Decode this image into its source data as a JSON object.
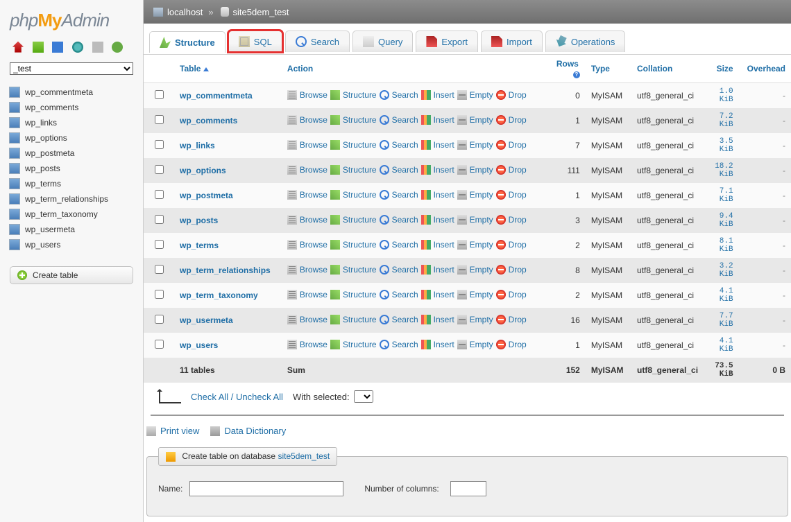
{
  "logo": {
    "p": "php",
    "m": "My",
    "a": "Admin"
  },
  "breadcrumb": {
    "server": "localhost",
    "db": "site5dem_test"
  },
  "db_selected": "_test",
  "tabs": [
    {
      "id": "structure",
      "label": "Structure",
      "active": true
    },
    {
      "id": "sql",
      "label": "SQL",
      "highlight": true
    },
    {
      "id": "search",
      "label": "Search"
    },
    {
      "id": "query",
      "label": "Query"
    },
    {
      "id": "export",
      "label": "Export"
    },
    {
      "id": "import",
      "label": "Import"
    },
    {
      "id": "operations",
      "label": "Operations"
    }
  ],
  "tree": [
    "wp_commentmeta",
    "wp_comments",
    "wp_links",
    "wp_options",
    "wp_postmeta",
    "wp_posts",
    "wp_terms",
    "wp_term_relationships",
    "wp_term_taxonomy",
    "wp_usermeta",
    "wp_users"
  ],
  "sidebar": {
    "create_table": "Create table"
  },
  "columns": {
    "table": "Table",
    "action": "Action",
    "rows": "Rows",
    "type": "Type",
    "collation": "Collation",
    "size": "Size",
    "overhead": "Overhead"
  },
  "actions": {
    "browse": "Browse",
    "structure": "Structure",
    "search": "Search",
    "insert": "Insert",
    "empty": "Empty",
    "drop": "Drop"
  },
  "tables": [
    {
      "name": "wp_commentmeta",
      "rows": 0,
      "type": "MyISAM",
      "collation": "utf8_general_ci",
      "size": "1.0\nKiB",
      "overhead": "-"
    },
    {
      "name": "wp_comments",
      "rows": 1,
      "type": "MyISAM",
      "collation": "utf8_general_ci",
      "size": "7.2\nKiB",
      "overhead": "-"
    },
    {
      "name": "wp_links",
      "rows": 7,
      "type": "MyISAM",
      "collation": "utf8_general_ci",
      "size": "3.5\nKiB",
      "overhead": "-"
    },
    {
      "name": "wp_options",
      "rows": 111,
      "type": "MyISAM",
      "collation": "utf8_general_ci",
      "size": "18.2\nKiB",
      "overhead": "-"
    },
    {
      "name": "wp_postmeta",
      "rows": 1,
      "type": "MyISAM",
      "collation": "utf8_general_ci",
      "size": "7.1\nKiB",
      "overhead": "-"
    },
    {
      "name": "wp_posts",
      "rows": 3,
      "type": "MyISAM",
      "collation": "utf8_general_ci",
      "size": "9.4\nKiB",
      "overhead": "-"
    },
    {
      "name": "wp_terms",
      "rows": 2,
      "type": "MyISAM",
      "collation": "utf8_general_ci",
      "size": "8.1\nKiB",
      "overhead": "-"
    },
    {
      "name": "wp_term_relationships",
      "rows": 8,
      "type": "MyISAM",
      "collation": "utf8_general_ci",
      "size": "3.2\nKiB",
      "overhead": "-"
    },
    {
      "name": "wp_term_taxonomy",
      "rows": 2,
      "type": "MyISAM",
      "collation": "utf8_general_ci",
      "size": "4.1\nKiB",
      "overhead": "-"
    },
    {
      "name": "wp_usermeta",
      "rows": 16,
      "type": "MyISAM",
      "collation": "utf8_general_ci",
      "size": "7.7\nKiB",
      "overhead": "-"
    },
    {
      "name": "wp_users",
      "rows": 1,
      "type": "MyISAM",
      "collation": "utf8_general_ci",
      "size": "4.1\nKiB",
      "overhead": "-"
    }
  ],
  "sum": {
    "label": "11 tables",
    "sum_label": "Sum",
    "rows": 152,
    "type": "MyISAM",
    "collation": "utf8_general_ci",
    "size": "73.5\nKiB",
    "overhead": "0 B"
  },
  "footer": {
    "check_all": "Check All / Uncheck All",
    "with_selected": "With selected:",
    "print_view": "Print view",
    "data_dictionary": "Data Dictionary",
    "create_legend_prefix": "Create table on database ",
    "create_legend_db": "site5dem_test",
    "name_label": "Name:",
    "cols_label": "Number of columns:"
  }
}
